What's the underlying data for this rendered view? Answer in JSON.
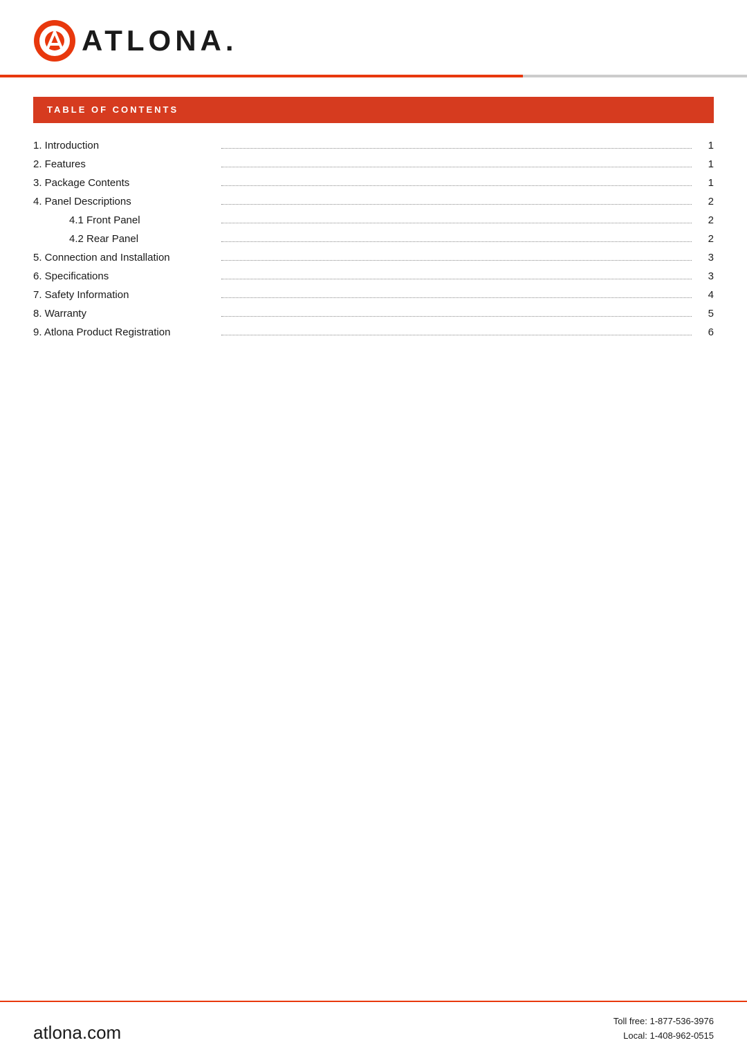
{
  "header": {
    "logo_text": "ATLONA.",
    "website": "atlona.com"
  },
  "toc": {
    "title": "TABLE OF CONTENTS",
    "items": [
      {
        "id": "item-1",
        "label": "1.  Introduction",
        "indented": false,
        "page": "1"
      },
      {
        "id": "item-2",
        "label": "2.  Features",
        "indented": false,
        "page": "1"
      },
      {
        "id": "item-3",
        "label": "3.  Package Contents",
        "indented": false,
        "page": "1"
      },
      {
        "id": "item-4",
        "label": "4.  Panel Descriptions",
        "indented": false,
        "page": "2"
      },
      {
        "id": "item-4-1",
        "label": "4.1 Front Panel",
        "indented": true,
        "page": "2"
      },
      {
        "id": "item-4-2",
        "label": "4.2 Rear Panel",
        "indented": true,
        "page": "2"
      },
      {
        "id": "item-5",
        "label": "5.  Connection and Installation",
        "indented": false,
        "page": "3"
      },
      {
        "id": "item-6",
        "label": "6.  Specifications",
        "indented": false,
        "page": "3"
      },
      {
        "id": "item-7",
        "label": "7.  Safety Information",
        "indented": false,
        "page": "4"
      },
      {
        "id": "item-8",
        "label": "8.  Warranty",
        "indented": false,
        "page": "5"
      },
      {
        "id": "item-9",
        "label": "9.  Atlona Product Registration",
        "indented": false,
        "page": "6"
      }
    ]
  },
  "footer": {
    "website": "atlona.com",
    "toll_free_label": "Toll free: 1-877-536-3976",
    "local_label": "Local: 1-408-962-0515"
  },
  "colors": {
    "brand_red": "#d63b1f",
    "accent_orange": "#e8380d",
    "text_dark": "#1a1a1a",
    "white": "#ffffff"
  }
}
